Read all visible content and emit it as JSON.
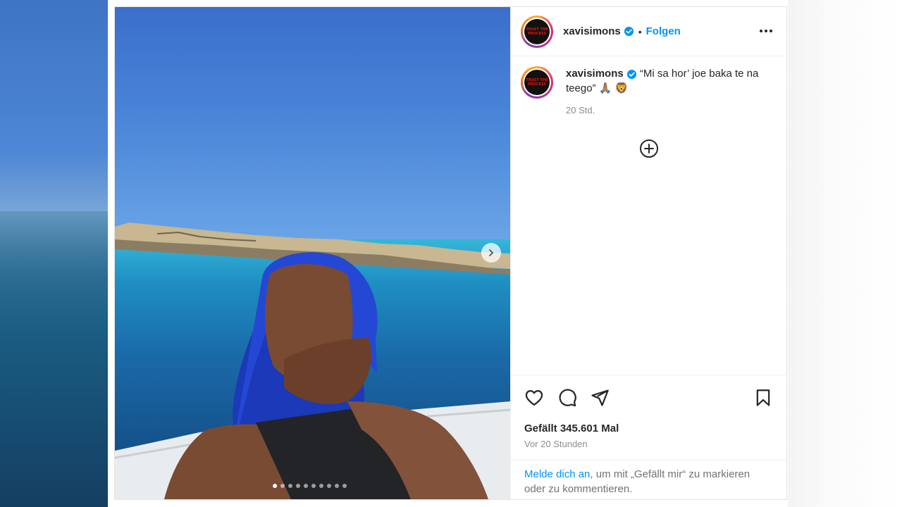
{
  "post": {
    "username": "xavisimons",
    "follow_label": "Folgen",
    "separator": "•",
    "avatar_text": "TRUST THE PROCESS",
    "caption": {
      "text": "“Mi sa hor’ joe baka te na teego” 🙏🏽 🦁",
      "time": "20 Std."
    },
    "likes": "Gefällt 345.601 Mal",
    "posted_ago": "Vor 20 Stunden",
    "login_prompt": {
      "link": "Melde dich an",
      "rest": ", um mit „Gefällt mir“ zu markieren oder zu kommentieren."
    },
    "carousel": {
      "total": 10,
      "current": 1
    }
  },
  "colors": {
    "link_blue": "#0095f6",
    "text": "#262626",
    "muted": "#8e8e8e"
  },
  "icons": [
    "verified-badge-icon",
    "more-options-icon",
    "add-icon",
    "heart-icon",
    "comment-icon",
    "share-icon",
    "bookmark-icon",
    "chevron-right-icon"
  ]
}
